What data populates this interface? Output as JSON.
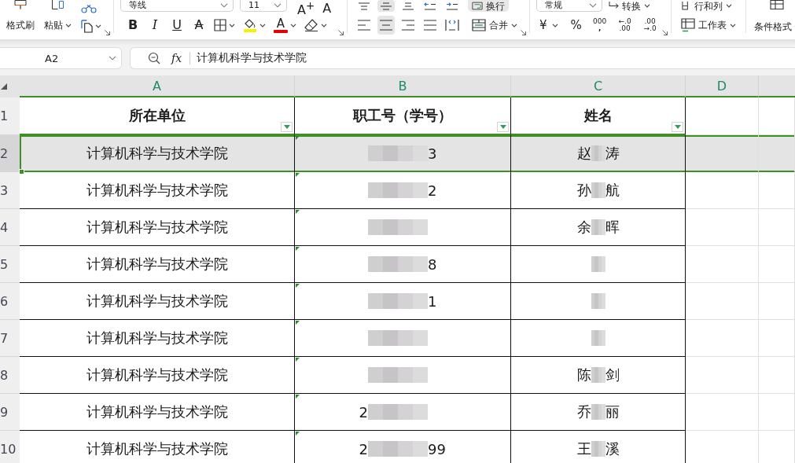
{
  "ribbon": {
    "clipboard": {
      "format_painter": "格式刷",
      "paste": "粘贴"
    },
    "font": {
      "font_name": "等线",
      "font_size": "11",
      "grow": "A$^{+}$",
      "shrink": "A",
      "bold": "B",
      "italic": "I",
      "underline": "U",
      "strikethrough": "A",
      "font_color": "A"
    },
    "alignment": {
      "vertical": [
        {
          "kind": "top",
          "selected": false
        },
        {
          "kind": "middle",
          "selected": true
        },
        {
          "kind": "bottom",
          "selected": false
        }
      ],
      "indent": [
        {
          "kind": "decrease"
        },
        {
          "kind": "increase"
        }
      ],
      "wrap": {
        "label": "换行",
        "selected": true
      },
      "horizontal": [
        {
          "kind": "left",
          "selected": false
        },
        {
          "kind": "center",
          "selected": true
        },
        {
          "kind": "right",
          "selected": false
        },
        {
          "kind": "justify",
          "selected": false
        },
        {
          "kind": "distributed",
          "selected": false
        }
      ],
      "merge": "合并"
    },
    "number": {
      "format": "常规",
      "convert": "转换",
      "currency": "¥",
      "percent": "%",
      "thousands": [
        "000",
        ","
      ],
      "increase_decimal": [
        "←.0",
        ".00"
      ],
      "decrease_decimal": [
        ".00",
        "→.0"
      ]
    },
    "cells": {
      "rows_columns": "行和列",
      "worksheet": "工作表"
    },
    "styles": {
      "conditional_format": "条件格式"
    }
  },
  "formula_bar": {
    "cell_ref": "A2",
    "fx": "fx",
    "content": "计算机科学与技术学院"
  },
  "sheet": {
    "columns": [
      {
        "label": "A",
        "selected": true
      },
      {
        "label": "B",
        "selected": true
      },
      {
        "label": "C",
        "selected": true
      },
      {
        "label": "D",
        "selected": true
      }
    ],
    "header": {
      "row": "1",
      "selected": false,
      "cells": [
        {
          "text": "所在单位",
          "filter": true
        },
        {
          "text": "职工号（学号）",
          "filter": true
        },
        {
          "text": "姓名",
          "filter": true
        }
      ]
    },
    "rows": [
      {
        "row": "2",
        "selected": true,
        "unit": {
          "text": "计算机科学与技术学院",
          "active": true
        },
        "id": {
          "after": "3",
          "flagged": true,
          "redacted": true
        },
        "name": {
          "before": "赵",
          "after": "涛",
          "redacted": true
        }
      },
      {
        "row": "3",
        "selected": false,
        "unit": {
          "text": "计算机科学与技术学院",
          "active": false
        },
        "id": {
          "after": "2",
          "flagged": true,
          "redacted": true
        },
        "name": {
          "before": "孙",
          "after": "航",
          "redacted": true
        }
      },
      {
        "row": "4",
        "selected": false,
        "unit": {
          "text": "计算机科学与技术学院",
          "active": false
        },
        "id": {
          "flagged": true,
          "redacted": true
        },
        "name": {
          "before": "余",
          "after": "晖",
          "redacted": true
        }
      },
      {
        "row": "5",
        "selected": false,
        "unit": {
          "text": "计算机科学与技术学院",
          "active": false
        },
        "id": {
          "after": "8",
          "flagged": true,
          "redacted": true
        },
        "name": {
          "redacted": true
        }
      },
      {
        "row": "6",
        "selected": false,
        "unit": {
          "text": "计算机科学与技术学院",
          "active": false
        },
        "id": {
          "after": "1",
          "flagged": true,
          "redacted": true
        },
        "name": {
          "redacted": true
        }
      },
      {
        "row": "7",
        "selected": false,
        "unit": {
          "text": "计算机科学与技术学院",
          "active": false
        },
        "id": {
          "flagged": true,
          "redacted": true
        },
        "name": {
          "redacted": true
        }
      },
      {
        "row": "8",
        "selected": false,
        "unit": {
          "text": "计算机科学与技术学院",
          "active": false
        },
        "id": {
          "flagged": true,
          "redacted": true
        },
        "name": {
          "before": "陈",
          "after": "剑",
          "redacted": true
        }
      },
      {
        "row": "9",
        "selected": false,
        "unit": {
          "text": "计算机科学与技术学院",
          "active": false
        },
        "id": {
          "before": "2",
          "flagged": true,
          "redacted": true
        },
        "name": {
          "before": "乔",
          "after": "丽",
          "redacted": true
        }
      },
      {
        "row": "10",
        "selected": false,
        "unit": {
          "text": "计算机科学与技术学院",
          "active": false
        },
        "id": {
          "before": "2",
          "after": "99",
          "flagged": true,
          "redacted": true
        },
        "name": {
          "before": "王",
          "after": "溪",
          "redacted": true
        }
      }
    ]
  }
}
